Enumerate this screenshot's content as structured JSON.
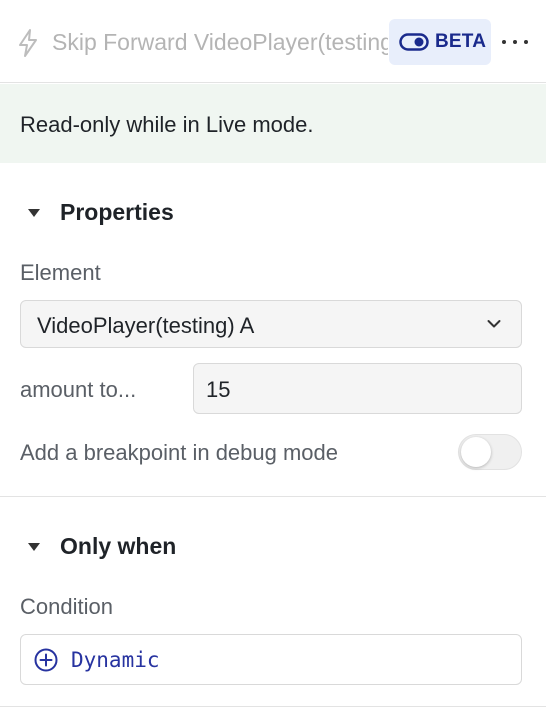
{
  "header": {
    "title": "Skip Forward VideoPlayer(testing) A",
    "beta_label": "BETA",
    "icons": {
      "action": "lightning-bolt-icon",
      "beta": "toggle-icon",
      "menu": "more-horizontal-icon"
    }
  },
  "banner": {
    "text": "Read-only while in Live mode."
  },
  "properties": {
    "title": "Properties",
    "element_label": "Element",
    "element_value": "VideoPlayer(testing) A",
    "amount_label": "amount to...",
    "amount_value": "15",
    "breakpoint_label": "Add a breakpoint in debug mode",
    "breakpoint_enabled": false
  },
  "only_when": {
    "title": "Only when",
    "condition_label": "Condition",
    "condition_value": "Dynamic"
  },
  "colors": {
    "accent": "#2733a0",
    "banner_bg": "#f0f6f1",
    "beta_bg": "#e8eefb"
  }
}
